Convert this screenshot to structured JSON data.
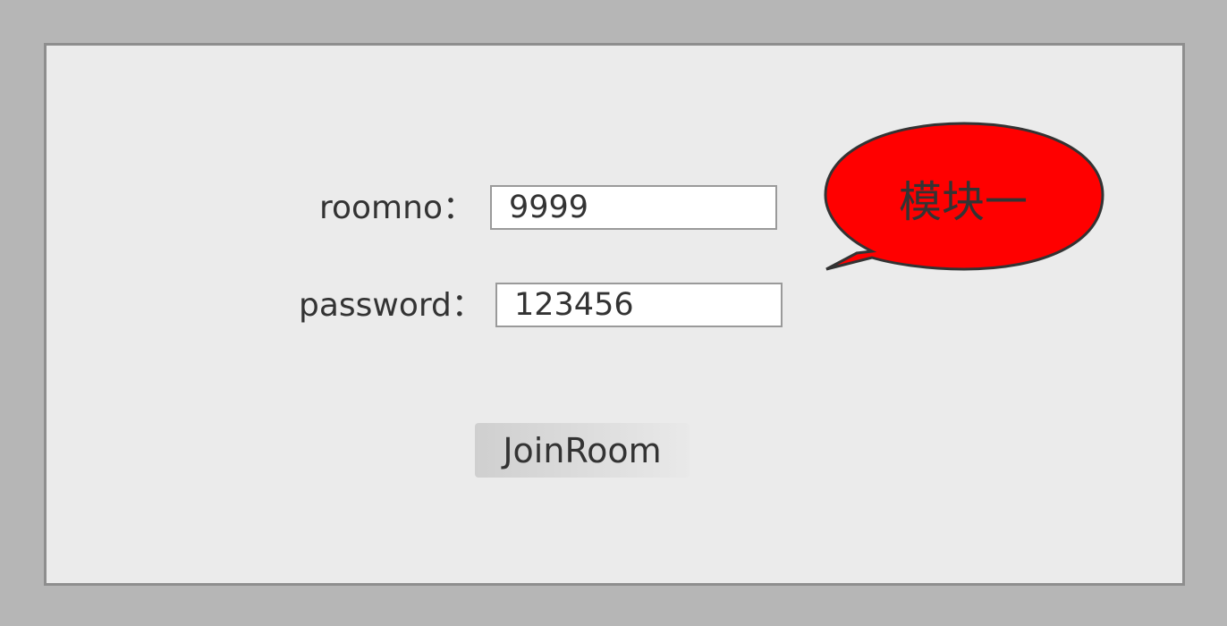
{
  "form": {
    "roomno_label": "roomno：",
    "roomno_value": "9999",
    "password_label": "password：",
    "password_value": "123456",
    "join_button_label": "JoinRoom"
  },
  "callout": {
    "text": "模块一",
    "fill_color": "#ff0000",
    "stroke_color": "#333333"
  },
  "colors": {
    "background": "#b6b6b6",
    "panel": "#ebebeb",
    "panel_border": "#8e8e8e",
    "text": "#333333"
  }
}
